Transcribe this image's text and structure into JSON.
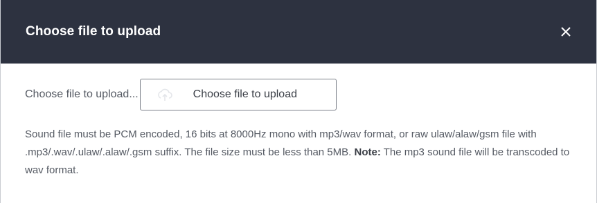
{
  "dialog": {
    "title": "Choose file to upload",
    "close_icon": "close-icon"
  },
  "upload": {
    "label": "Choose file to upload...",
    "button_label": "Choose file to upload",
    "button_icon": "upload-icon"
  },
  "help": {
    "text_before": "Sound file must be PCM encoded, 16 bits at 8000Hz mono with mp3/wav format, or raw ulaw/alaw/gsm file with .mp3/.wav/.ulaw/.alaw/.gsm suffix. The file size must be less than 5MB. ",
    "note_label": "Note:",
    "text_after": " The mp3 sound file will be transcoded to wav format."
  },
  "colors": {
    "header_bg": "#2d3240",
    "header_text": "#ffffff",
    "body_text": "#555a63",
    "button_border": "#7a7f88"
  }
}
